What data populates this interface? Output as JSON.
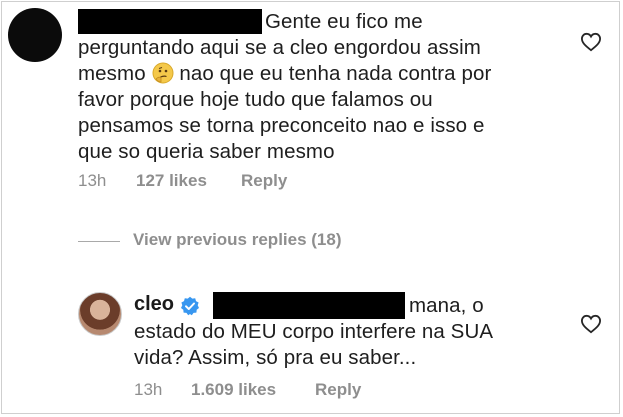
{
  "comment1": {
    "line1": "Gente eu fico me",
    "line2": "perguntando aqui se a cleo engordou assim",
    "line3a": "mesmo",
    "emoji": "thinking-face",
    "line3b": "nao que eu tenha nada contra por",
    "line4": "favor porque hoje tudo que falamos ou",
    "line5": "pensamos se torna preconceito nao e isso e",
    "line6": "que so queria saber mesmo",
    "time": "13h",
    "likes": "127 likes",
    "reply": "Reply"
  },
  "view_previous": "View previous replies (18)",
  "comment2": {
    "username": "cleo",
    "line1": "mana, o",
    "line2": "estado do MEU corpo interfere na SUA",
    "line3": "vida? Assim, só pra eu saber...",
    "time": "13h",
    "likes": "1.609 likes",
    "reply": "Reply"
  },
  "colors": {
    "text": "#1e1e1e",
    "meta": "#8e8e8e",
    "verified": "#3897f0",
    "redaction": "#000000"
  },
  "icons": [
    "heart-outline-icon",
    "verified-badge-icon",
    "thinking-face-emoji"
  ]
}
